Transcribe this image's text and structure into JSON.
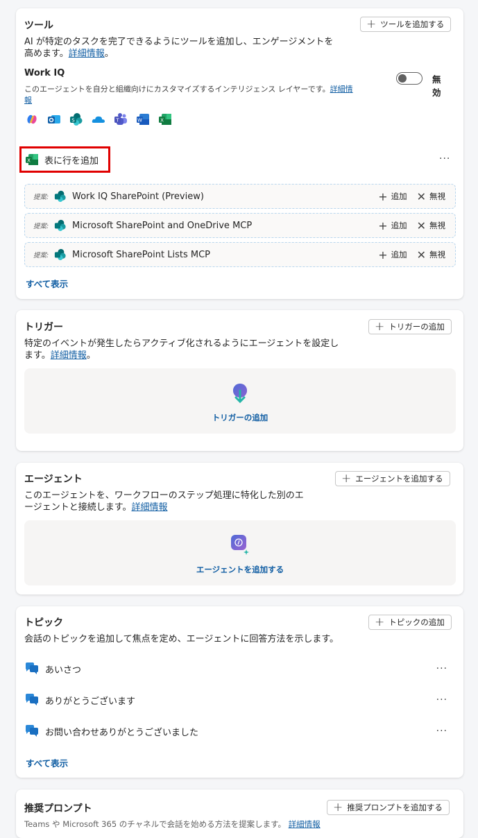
{
  "tools": {
    "title": "ツール",
    "add_label": "ツールを追加する",
    "desc_line1": "AI が特定のタスクを完了できるようにツールを追加し、エンゲージメントを",
    "desc_line2": "高めます。",
    "desc_link": "詳細情報",
    "desc_end": "。",
    "work_iq": {
      "title": "Work IQ",
      "desc": "このエージェントを自分と組織向けにカスタマイズするインテリジェンス レイヤーです。",
      "link1": "詳細情",
      "link2": "報",
      "toggle_label1": "無",
      "toggle_label2": "効",
      "toggle_on": false,
      "apps": [
        "copilot-icon",
        "outlook-icon",
        "sharepoint-icon",
        "onedrive-icon",
        "teams-icon",
        "word-icon",
        "excel-icon"
      ]
    },
    "highlighted_tool": "表に行を追加",
    "more": "···",
    "suggestion_tag": "提案:",
    "suggestions": [
      {
        "name": "Work IQ SharePoint (Preview)"
      },
      {
        "name": "Microsoft SharePoint and OneDrive MCP"
      },
      {
        "name": "Microsoft SharePoint Lists MCP"
      }
    ],
    "add_action": "追加",
    "ignore_action": "無視",
    "show_all": "すべて表示"
  },
  "triggers": {
    "title": "トリガー",
    "add_label": "トリガーの追加",
    "desc_line1": "特定のイベントが発生したらアクティブ化されるようにエージェントを設定し",
    "desc_line2": "ます。",
    "desc_link": "詳細情報",
    "desc_end": "。",
    "empty_label": "トリガーの追加"
  },
  "agents": {
    "title": "エージェント",
    "add_label": "エージェントを追加する",
    "desc_line1": "このエージェントを、ワークフローのステップ処理に特化した別のエ",
    "desc_line2": "ージェントと接続します。",
    "desc_link": "詳細情報",
    "empty_label": "エージェントを追加する"
  },
  "topics": {
    "title": "トピック",
    "add_label": "トピックの追加",
    "desc": "会話のトピックを追加して焦点を定め、エージェントに回答方法を示します。",
    "items": [
      {
        "label": "あいさつ"
      },
      {
        "label": "ありがとうございます"
      },
      {
        "label": "お問い合わせありがとうございました"
      }
    ],
    "more": "···",
    "show_all": "すべて表示"
  },
  "prompts": {
    "title": "推奨プロンプト",
    "add_label": "推奨プロンプトを追加する",
    "desc": "Teams や Microsoft 365 のチャネルで会話を始める方法を提案します。",
    "desc_link": "詳細情報"
  },
  "colors": {
    "link": "#115ea3",
    "highlight": "#e00000",
    "excel_green": "#107c41"
  }
}
